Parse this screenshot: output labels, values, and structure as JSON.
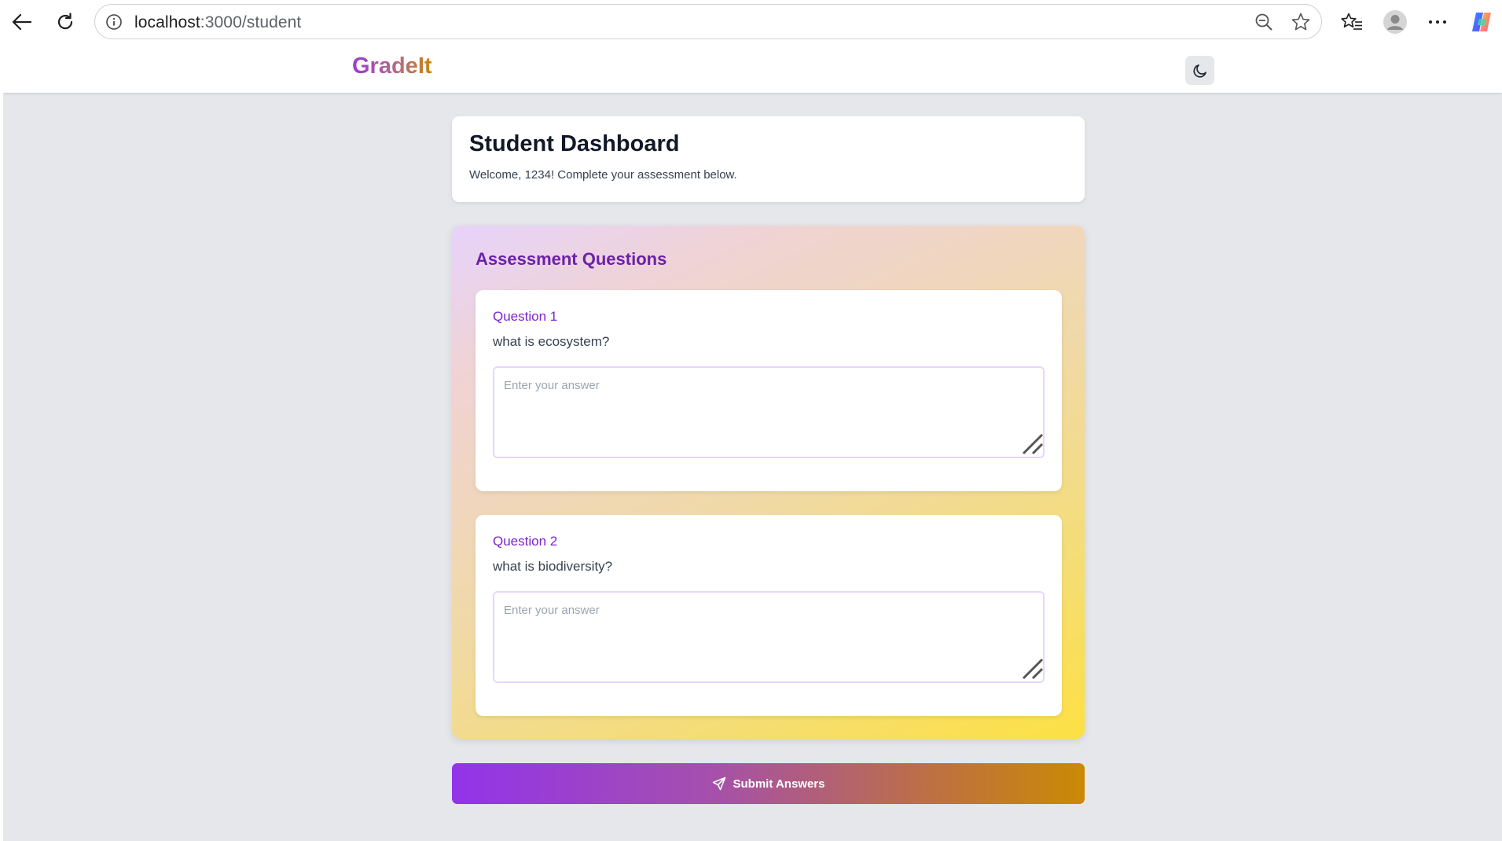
{
  "browser": {
    "url_host": "localhost",
    "url_path": ":3000/student",
    "icons": [
      "back-arrow-icon",
      "reload-icon",
      "site-info-icon",
      "zoom-out-icon",
      "star-icon",
      "favorites-icon",
      "profile-icon",
      "more-icon",
      "copilot-icon"
    ]
  },
  "header": {
    "logo": "GradeIt",
    "theme_toggle_icon": "moon-icon"
  },
  "dashboard": {
    "title": "Student Dashboard",
    "welcome": "Welcome, 1234! Complete your assessment below."
  },
  "assessment": {
    "title": "Assessment Questions",
    "questions": [
      {
        "label": "Question 1",
        "text": "what is ecosystem?",
        "placeholder": "Enter your answer",
        "value": ""
      },
      {
        "label": "Question 2",
        "text": "what is biodiversity?",
        "placeholder": "Enter your answer",
        "value": ""
      }
    ]
  },
  "submit": {
    "label": "Submit Answers",
    "icon": "send-icon"
  },
  "colors": {
    "brand_purple": "#9333ea",
    "brand_gold": "#ca8a04",
    "heading_purple": "#6b21a8",
    "page_bg": "#e5e7eb"
  }
}
